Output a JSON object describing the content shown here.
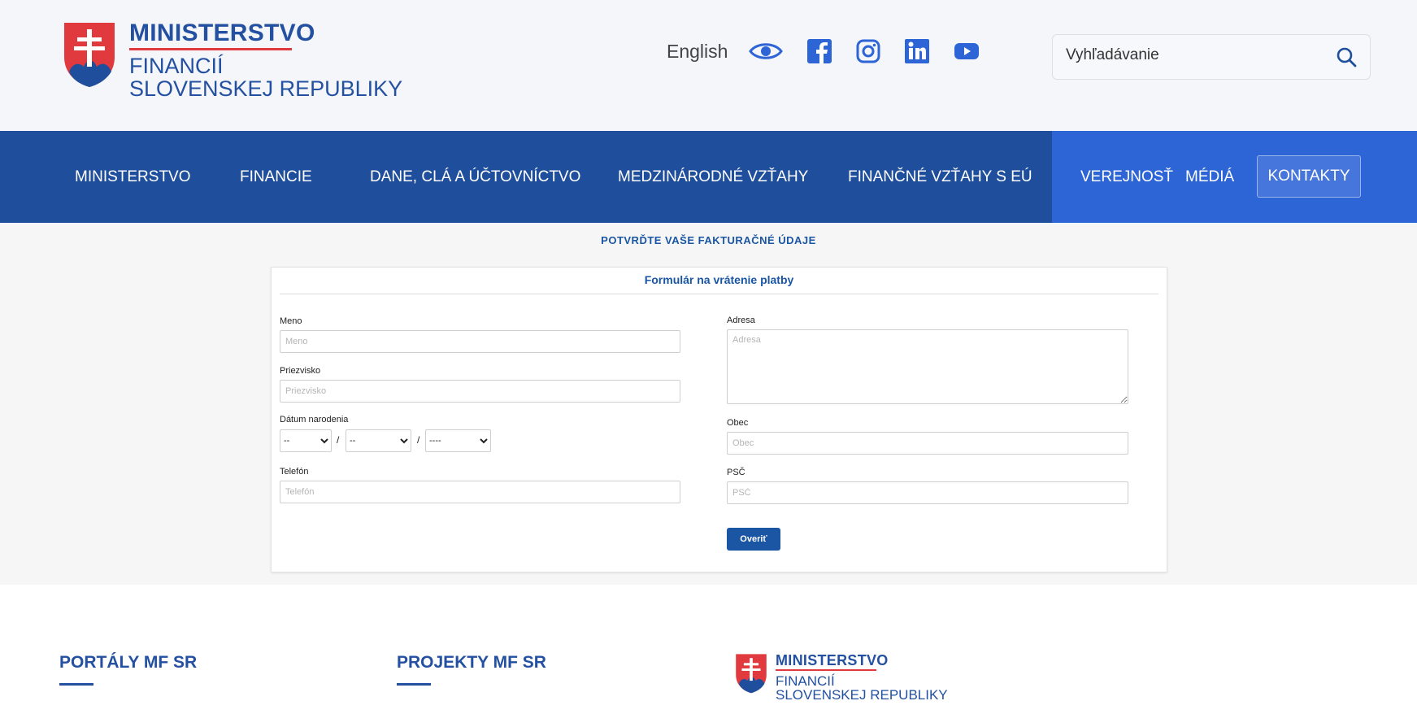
{
  "header": {
    "logo": {
      "line1": "MINISTERSTVO",
      "line2": "FINANCIÍ",
      "line3": "SLOVENSKEJ REPUBLIKY"
    },
    "language_link": "English",
    "icons": [
      "eye-icon",
      "facebook-icon",
      "instagram-icon",
      "linkedin-icon",
      "youtube-icon"
    ],
    "search": {
      "placeholder": "Vyhľadávanie"
    }
  },
  "nav": {
    "items": [
      "MINISTERSTVO",
      "FINANCIE",
      "DANE, CLÁ A ÚČTOVNÍCTVO",
      "MEDZINÁRODNÉ VZŤAHY",
      "FINANČNÉ VZŤAHY S EÚ"
    ],
    "right_items": [
      "VEREJNOSŤ",
      "MÉDIÁ"
    ],
    "contact": "KONTAKTY"
  },
  "page": {
    "heading": "POTVRĎTE VAŠE FAKTURAČNÉ ÚDAJE",
    "form_title": "Formulár na vrátenie platby",
    "fields": {
      "meno": {
        "label": "Meno",
        "placeholder": "Meno"
      },
      "priezvisko": {
        "label": "Priezvisko",
        "placeholder": "Priezvisko"
      },
      "datum": {
        "label": "Dátum narodenia",
        "day": "--",
        "month": "--",
        "year": "----",
        "separator": "/"
      },
      "telefon": {
        "label": "Telefón",
        "placeholder": "Telefón"
      },
      "adresa": {
        "label": "Adresa",
        "placeholder": "Adresa"
      },
      "obec": {
        "label": "Obec",
        "placeholder": "Obec"
      },
      "psc": {
        "label": "PSČ",
        "placeholder": "PSČ"
      }
    },
    "submit": "Overiť"
  },
  "footer": {
    "col1": "PORTÁLY MF SR",
    "col2": "PROJEKTY MF SR",
    "logo": {
      "line1": "MINISTERSTVO",
      "line2": "FINANCIÍ",
      "line3": "SLOVENSKEJ REPUBLIKY"
    }
  },
  "colors": {
    "primary": "#1f4f9c",
    "accent_nav": "#2d64d6",
    "brand_red": "#e03a3e",
    "link": "#1a56a3"
  }
}
